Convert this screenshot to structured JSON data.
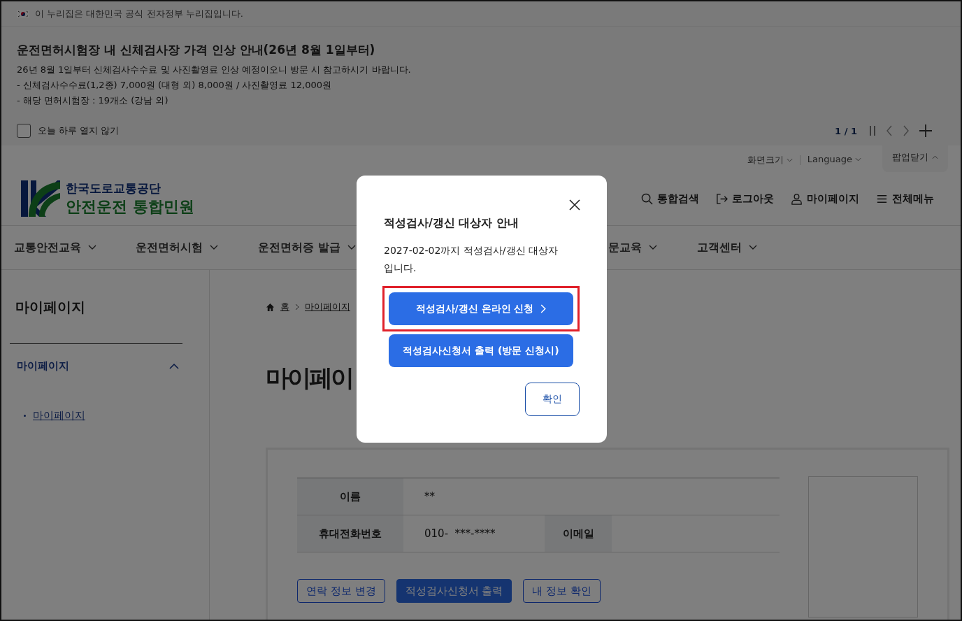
{
  "gov_banner": {
    "text": "이 누리집은 대한민국 공식 전자정부 누리집입니다."
  },
  "notice_popup": {
    "title": "운전면허시험장 내 신체검사장 가격 인상 안내(26년 8월 1일부터)",
    "lines": [
      "26년 8월 1일부터 신체검사수수료 및 사진촬영료 인상 예정이오니 방문 시 참고하시기 바랍니다.",
      "- 신체검사수수료(1,2종) 7,000원 (대형 외) 8,000원 / 사진촬영료 12,000원",
      "- 해당 면허시험장 : 19개소 (강남 외)"
    ],
    "dismiss": {
      "label": "오늘 하루 열지 않기",
      "checked": false
    },
    "pager": "1 / 1",
    "toggle": {
      "label": "팝업닫기",
      "expanded": true
    }
  },
  "utility": [
    {
      "label": "화면크기"
    },
    {
      "label": "Language"
    }
  ],
  "logo": {
    "org": "한국도로교통공단",
    "service": "안전운전 통합민원"
  },
  "header_links": [
    {
      "label": "통합검색",
      "kind": "search"
    },
    {
      "label": "로그아웃",
      "kind": "logout"
    },
    {
      "label": "마이페이지",
      "kind": "user"
    },
    {
      "label": "전체메뉴",
      "kind": "menu"
    }
  ],
  "nav": [
    {
      "label": "교통안전교육"
    },
    {
      "label": "운전면허시험"
    },
    {
      "label": "운전면허증 발급"
    },
    {
      "label": "문교육"
    },
    {
      "label": "고객센터"
    }
  ],
  "sidebar": {
    "title": "마이페이지",
    "menu": {
      "label": "마이페이지",
      "expanded": true,
      "children": [
        {
          "label": "마이페이지"
        }
      ]
    }
  },
  "breadcrumb": [
    "홈",
    "마이페이지"
  ],
  "page_title": "마이페이",
  "profile": {
    "fields": [
      {
        "label": "이름",
        "value": "**"
      },
      {
        "label": "휴대전화번호",
        "value": "010-  ***-****"
      },
      {
        "label": "이메일"
      }
    ],
    "buttons": [
      {
        "label": "연락 정보 변경",
        "kind": "outline"
      },
      {
        "label": "적성검사신청서 출력",
        "kind": "primary"
      },
      {
        "label": "내 정보 확인",
        "kind": "outline"
      }
    ]
  },
  "modal": {
    "title": "적성검사/갱신 대상자 안내",
    "message": "2027-02-02까지 적성검사/갱신 대상자입니다.",
    "actions": [
      {
        "label": "적성검사/갱신 온라인 신청",
        "highlighted": true,
        "arrow": true
      },
      {
        "label": "적성검사신청서 출력 (방문 신청시)",
        "highlighted": false,
        "arrow": false
      }
    ],
    "confirm": "확인"
  }
}
